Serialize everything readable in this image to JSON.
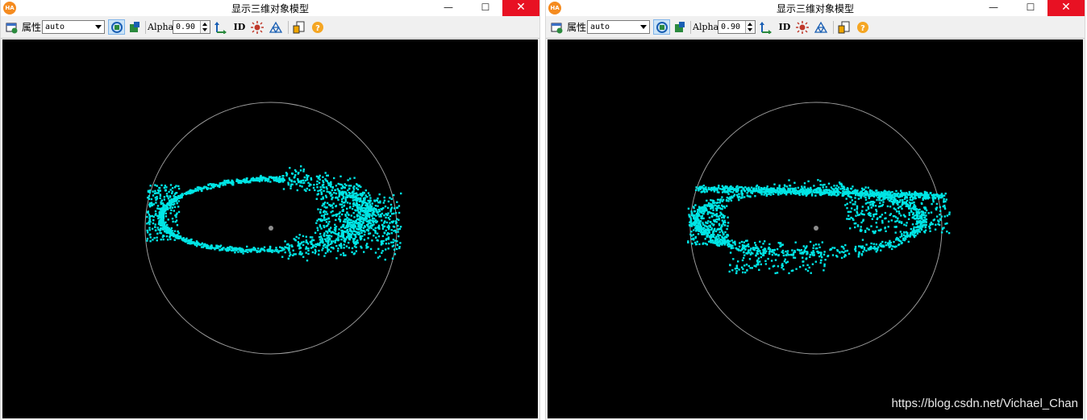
{
  "windows": [
    {
      "id": "left",
      "app_icon_text": "HA",
      "title": "显示三维对象模型",
      "toolbar": {
        "properties_label": "属性",
        "mode_value": "auto",
        "alpha_label": "Alpha",
        "alpha_value": "0.90",
        "id_label": "ID"
      },
      "scene": "a"
    },
    {
      "id": "right",
      "app_icon_text": "HA",
      "title": "显示三维对象模型",
      "toolbar": {
        "properties_label": "属性",
        "mode_value": "auto",
        "alpha_label": "Alpha",
        "alpha_value": "0.90",
        "id_label": "ID"
      },
      "scene": "b"
    }
  ],
  "icons": {
    "app": "halcon-app-icon",
    "properties": "properties-icon",
    "rotate": "rotate-view-icon",
    "move": "move-view-icon",
    "axes": "coordinate-axes-icon",
    "id": "id-icon",
    "light": "light-icon",
    "mesh": "mesh-icon",
    "export": "export-icon",
    "help": "help-icon"
  },
  "colors": {
    "points": "#00e5e5",
    "sphere": "#9a9a9a",
    "center": "#8c8c8c",
    "background": "#000000",
    "close_button": "#e81123",
    "app_icon": "#f58b1f"
  },
  "watermark": "https://blog.csdn.net/Vichael_Chan"
}
